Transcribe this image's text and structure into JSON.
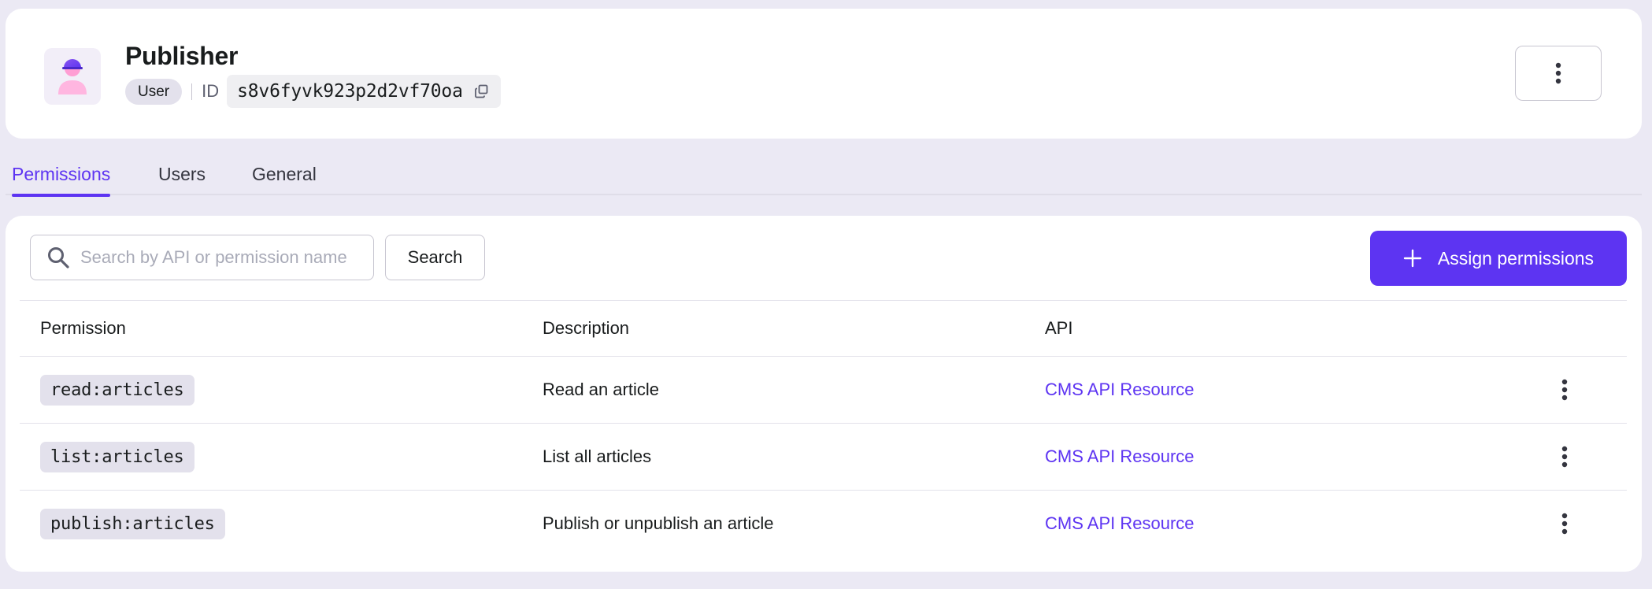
{
  "header": {
    "title": "Publisher",
    "role_type": "User",
    "id_label": "ID",
    "id_value": "s8v6fyvk923p2d2vf70oa",
    "icons": {
      "avatar": "role-person-icon",
      "copy": "copy-icon",
      "more": "more-vertical-icon"
    }
  },
  "tabs": [
    {
      "label": "Permissions",
      "active": true
    },
    {
      "label": "Users",
      "active": false
    },
    {
      "label": "General",
      "active": false
    }
  ],
  "toolbar": {
    "search_placeholder": "Search by API or permission name",
    "search_value": "",
    "search_button_label": "Search",
    "assign_button_label": "Assign permissions"
  },
  "table": {
    "columns": [
      "Permission",
      "Description",
      "API"
    ],
    "rows": [
      {
        "permission": "read:articles",
        "description": "Read an article",
        "api": "CMS API Resource"
      },
      {
        "permission": "list:articles",
        "description": "List all articles",
        "api": "CMS API Resource"
      },
      {
        "permission": "publish:articles",
        "description": "Publish or unpublish an article",
        "api": "CMS API Resource"
      }
    ]
  },
  "colors": {
    "accent": "#5d34f2",
    "page_background": "#ebe9f4",
    "card_background": "#ffffff",
    "tag_background": "#e3e1ec"
  }
}
